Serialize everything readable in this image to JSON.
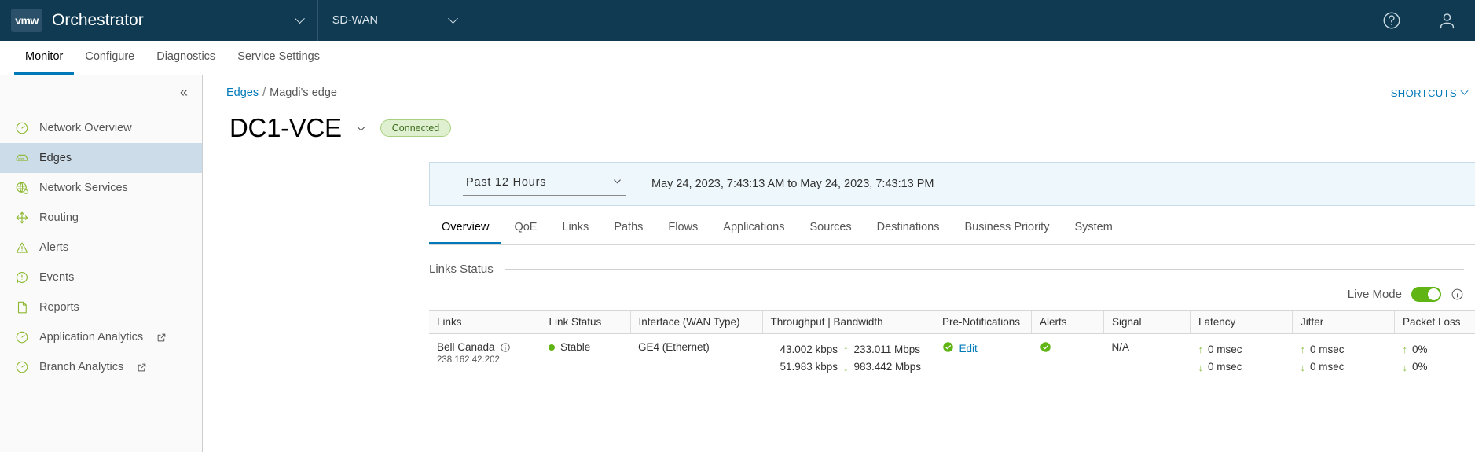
{
  "header": {
    "logo_text": "vmw",
    "title": "Orchestrator",
    "customer_select": "",
    "product_select": "SD-WAN",
    "help_icon": "help-circle-icon",
    "user_icon": "user-icon"
  },
  "nav_tabs": [
    {
      "label": "Monitor",
      "active": true
    },
    {
      "label": "Configure",
      "active": false
    },
    {
      "label": "Diagnostics",
      "active": false
    },
    {
      "label": "Service Settings",
      "active": false
    }
  ],
  "sidebar": {
    "collapse_icon": "double-chevron-left-icon",
    "items": [
      {
        "label": "Network Overview",
        "icon": "gauge-icon",
        "active": false,
        "external": false
      },
      {
        "label": "Edges",
        "icon": "edge-device-icon",
        "active": true,
        "external": false
      },
      {
        "label": "Network Services",
        "icon": "network-globe-icon",
        "active": false,
        "external": false
      },
      {
        "label": "Routing",
        "icon": "routing-icon",
        "active": false,
        "external": false
      },
      {
        "label": "Alerts",
        "icon": "warning-triangle-icon",
        "active": false,
        "external": false
      },
      {
        "label": "Events",
        "icon": "exclamation-bubble-icon",
        "active": false,
        "external": false
      },
      {
        "label": "Reports",
        "icon": "document-icon",
        "active": false,
        "external": false
      },
      {
        "label": "Application Analytics",
        "icon": "gauge-icon",
        "active": false,
        "external": true
      },
      {
        "label": "Branch Analytics",
        "icon": "gauge-icon",
        "active": false,
        "external": true
      }
    ]
  },
  "breadcrumb": {
    "root": "Edges",
    "separator": "/",
    "current": "Magdi's edge"
  },
  "shortcuts_label": "SHORTCUTS",
  "page": {
    "title": "DC1-VCE",
    "status_badge": "Connected"
  },
  "time_filter": {
    "selected": "Past 12 Hours",
    "range_text": "May 24, 2023, 7:43:13 AM to May 24, 2023, 7:43:13 PM"
  },
  "sub_tabs": [
    {
      "label": "Overview",
      "active": true
    },
    {
      "label": "QoE",
      "active": false
    },
    {
      "label": "Links",
      "active": false
    },
    {
      "label": "Paths",
      "active": false
    },
    {
      "label": "Flows",
      "active": false
    },
    {
      "label": "Applications",
      "active": false
    },
    {
      "label": "Sources",
      "active": false
    },
    {
      "label": "Destinations",
      "active": false
    },
    {
      "label": "Business Priority",
      "active": false
    },
    {
      "label": "System",
      "active": false
    }
  ],
  "links_section": {
    "title": "Links Status",
    "live_mode_label": "Live Mode",
    "live_mode_on": true,
    "info_icon": "info-circle-icon"
  },
  "table": {
    "columns": [
      "Links",
      "Link Status",
      "Interface (WAN Type)",
      "Throughput | Bandwidth",
      "Pre-Notifications",
      "Alerts",
      "Signal",
      "Latency",
      "Jitter",
      "Packet Loss"
    ],
    "rows": [
      {
        "link_name": "Bell Canada",
        "link_ip": "238.162.42.202",
        "link_status": "Stable",
        "interface": "GE4 (Ethernet)",
        "throughput_up": "43.002 kbps",
        "bandwidth_up": "233.011 Mbps",
        "throughput_down": "51.983 kbps",
        "bandwidth_down": "983.442 Mbps",
        "pre_notifications": "Edit",
        "alerts": "enabled-check",
        "signal": "N/A",
        "latency_up": "0 msec",
        "latency_down": "0 msec",
        "jitter_up": "0 msec",
        "jitter_down": "0 msec",
        "packet_loss_up": "0%",
        "packet_loss_down": "0%"
      }
    ]
  },
  "colors": {
    "header_bg": "#0f3a52",
    "accent_blue": "#0079b8",
    "accent_green": "#60b515",
    "badge_bg": "#dff0d0",
    "sidebar_active": "#ccdce9",
    "timebar_bg": "#eef7fb"
  }
}
